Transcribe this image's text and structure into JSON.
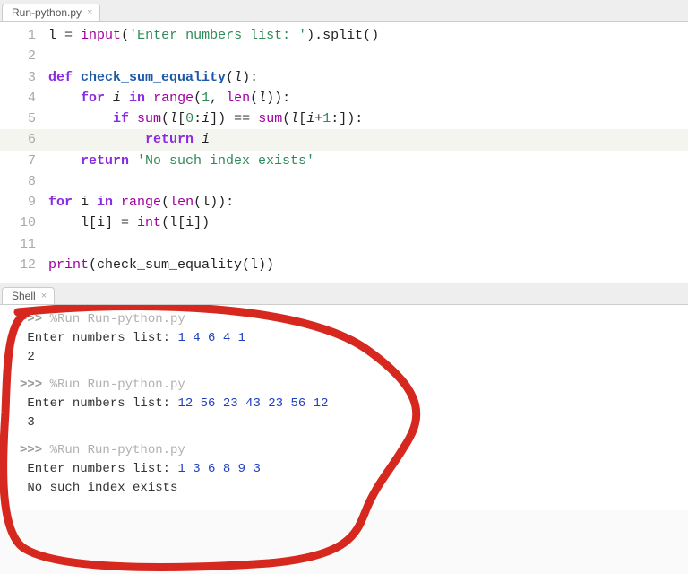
{
  "tabs": {
    "editor": "Run-python.py",
    "shell": "Shell"
  },
  "code": {
    "l1": {
      "n": "1",
      "pre": "",
      "tokens": [
        "l ",
        "=",
        "  ",
        "input",
        "(",
        "'Enter numbers list: '",
        ")",
        ".split",
        "()"
      ]
    },
    "l2": {
      "n": "2",
      "text": ""
    },
    "l3": {
      "n": "3",
      "pre": "",
      "kw1": "def ",
      "name": "check_sum_equality",
      "rest": "(",
      "arg": "l",
      "close": "):"
    },
    "l4": {
      "n": "4",
      "indent": "    ",
      "kw": "for ",
      "v": "i",
      "in": " in ",
      "fn": "range",
      "open": "(",
      "a": "1",
      "comma": ", ",
      "fn2": "len",
      "o2": "(",
      "arg2": "l",
      "c2": ")):",
      "c1": ""
    },
    "l5": {
      "n": "5",
      "indent": "        ",
      "kw": "if ",
      "fn": "sum",
      "o": "(",
      "v": "l",
      "b1": "[",
      "a": "0",
      "colon": ":",
      "b": "i",
      "b2": "]) ",
      "eq": "== ",
      "fn2": "sum",
      "o2": "(",
      "v2": "l",
      "b3": "[",
      "c": "i",
      "plus": "+",
      "d": "1",
      "colon2": ":",
      "b4": "]):"
    },
    "l6": {
      "n": "6",
      "indent": "            ",
      "kw": "return ",
      "v": "i"
    },
    "l7": {
      "n": "7",
      "indent": "    ",
      "kw": "return ",
      "s": "'No such index exists'"
    },
    "l8": {
      "n": "8",
      "text": ""
    },
    "l9": {
      "n": "9",
      "pre": "",
      "kw": "for ",
      "v": "i",
      "in": " in ",
      "fn": "range",
      "o": "(",
      "fn2": "len",
      "o2": "(l)):"
    },
    "l10": {
      "n": "10",
      "indent": "    ",
      "a": "l[i] ",
      "eq": "= ",
      "fn": "int",
      "rest": "(l[i])"
    },
    "l11": {
      "n": "11",
      "text": ""
    },
    "l12": {
      "n": "12",
      "pre": "",
      "fn": "print",
      "o": "(",
      "fn2": "check_sum_equality",
      "rest": "(l))"
    }
  },
  "shell": {
    "prompt": ">>> ",
    "runcmd": "%Run Run-python.py",
    "input_label": "Enter numbers list: ",
    "runs": [
      {
        "input": "1 4 6 4 1",
        "output": "2"
      },
      {
        "input": "12 56 23 43 23 56 12",
        "output": "3"
      },
      {
        "input": "1 3 6 8 9 3",
        "output": "No such index exists"
      }
    ]
  }
}
